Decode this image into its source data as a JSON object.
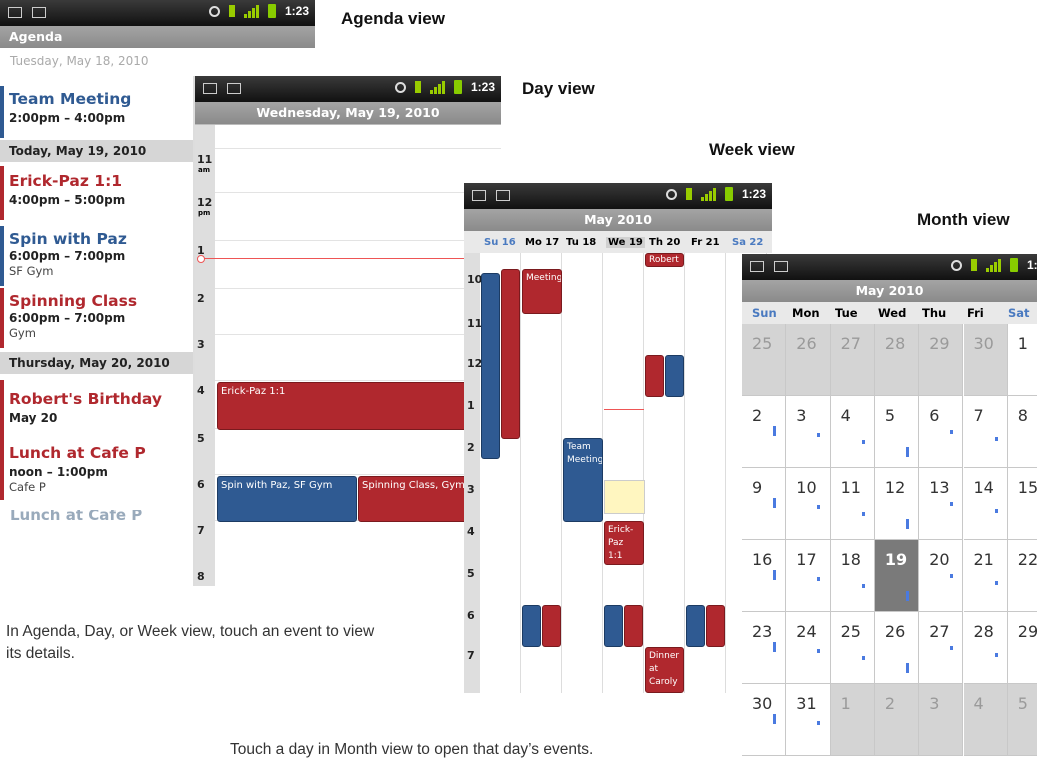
{
  "captions": {
    "agenda": "Agenda view",
    "day": "Day view",
    "week": "Week view",
    "month": "Month view"
  },
  "notes": {
    "agenda_day_week": "In Agenda, Day, or Week view, touch an event to view its details.",
    "month": "Touch a day in Month view to open that day’s events."
  },
  "status_time": "1:23",
  "agenda": {
    "title": "Agenda",
    "cut_header": "Tuesday, May 18, 2010",
    "items": [
      {
        "title": "Team Meeting",
        "time": "2:00pm – 4:00pm",
        "loc": "",
        "color": "#2f5a92"
      },
      {
        "title": "Erick-Paz 1:1",
        "time": "4:00pm – 5:00pm",
        "loc": "",
        "color": "#b0282e"
      },
      {
        "title": "Spin with Paz",
        "time": "6:00pm – 7:00pm",
        "loc": "SF Gym",
        "color": "#2f5a92"
      },
      {
        "title": "Spinning Class",
        "time": "6:00pm – 7:00pm",
        "loc": "Gym",
        "color": "#b0282e"
      },
      {
        "title": "Robert's Birthday",
        "time": "May 20",
        "loc": "",
        "color": "#b0282e"
      },
      {
        "title": "Lunch at Cafe P",
        "time": "noon – 1:00pm",
        "loc": "Cafe P",
        "color": "#b0282e"
      }
    ],
    "headers": [
      "Today, May 19, 2010",
      "Thursday, May 20, 2010"
    ],
    "cut_item": "Lunch at Cafe P"
  },
  "day": {
    "title": "Wednesday, May 19, 2010",
    "hours": [
      "11",
      "12",
      "1",
      "2",
      "3",
      "4",
      "5",
      "6",
      "7",
      "8"
    ],
    "am": "am",
    "pm": "pm",
    "events": [
      "Erick-Paz 1:1",
      "Spin with Paz, SF Gym",
      "Spinning Class, Gym"
    ]
  },
  "week": {
    "title": "May 2010",
    "days": [
      "Su 16",
      "Mo 17",
      "Tu 18",
      "We 19",
      "Th 20",
      "Fr 21",
      "Sa 22"
    ],
    "hours": [
      "10",
      "11",
      "12",
      "1",
      "2",
      "3",
      "4",
      "5",
      "6",
      "7"
    ],
    "events": [
      "Robert",
      "Meeting",
      "Team Meeting",
      "Erick-Paz 1:1",
      "Dinner at Caroly"
    ]
  },
  "month": {
    "title": "May 2010",
    "weekdays": [
      "Sun",
      "Mon",
      "Tue",
      "Wed",
      "Thu",
      "Fri",
      "Sat"
    ],
    "rows": [
      [
        "25",
        "26",
        "27",
        "28",
        "29",
        "30",
        "1"
      ],
      [
        "2",
        "3",
        "4",
        "5",
        "6",
        "7",
        "8"
      ],
      [
        "9",
        "10",
        "11",
        "12",
        "13",
        "14",
        "15"
      ],
      [
        "16",
        "17",
        "18",
        "19",
        "20",
        "21",
        "22"
      ],
      [
        "23",
        "24",
        "25",
        "26",
        "27",
        "28",
        "29"
      ],
      [
        "30",
        "31",
        "1",
        "2",
        "3",
        "4",
        "5"
      ]
    ],
    "today": "19"
  },
  "colors": {
    "red": "#b0282e",
    "blue": "#2f5a92",
    "status_green": "#99cc00"
  }
}
